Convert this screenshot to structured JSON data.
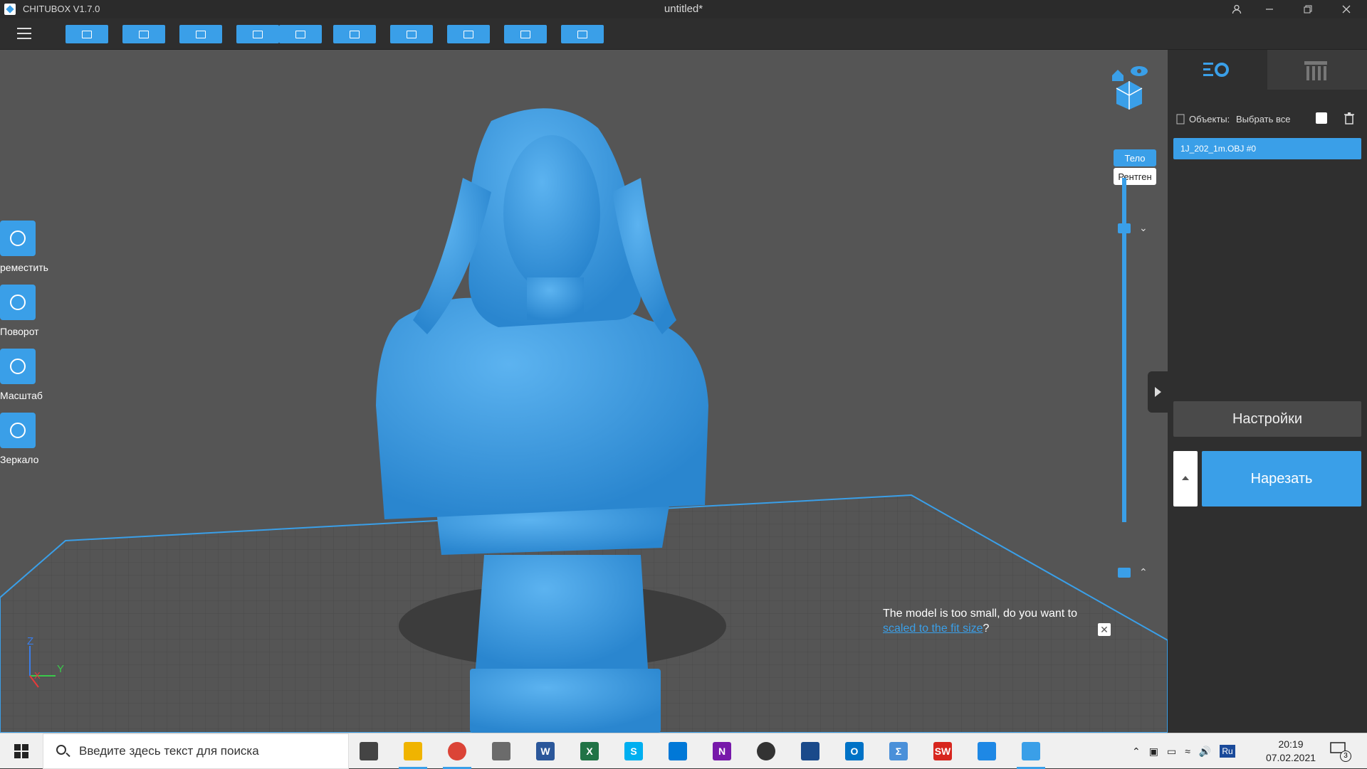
{
  "window": {
    "app_name": "CHITUBOX V1.7.0",
    "document_title": "untitled*"
  },
  "toolbar": {
    "buttons": [
      "open-file",
      "save",
      "import",
      "undo",
      "redo",
      "copy",
      "arrange",
      "support",
      "hollow",
      "dig-hole"
    ]
  },
  "left_tools": [
    {
      "label": "Переместить",
      "visible_label": "реместить",
      "icon": "move-icon"
    },
    {
      "label": "Поворот",
      "visible_label": "Поворот",
      "icon": "rotate-icon"
    },
    {
      "label": "Масштаб",
      "visible_label": "Масштаб",
      "icon": "scale-icon"
    },
    {
      "label": "Зеркало",
      "visible_label": "Зеркало",
      "icon": "mirror-icon"
    }
  ],
  "view_modes": {
    "body": "Тело",
    "xray": "Рентген",
    "active": "body"
  },
  "axes": {
    "z": "Z",
    "y": "Y",
    "x": "X"
  },
  "notice": {
    "text": "The model is too small, do you want to",
    "link": "scaled to the fit size",
    "suffix": "?"
  },
  "sidepanel": {
    "objects_label": "Объекты:",
    "select_all_label": "Выбрать все",
    "objects": [
      "1J_202_1m.OBJ #0"
    ],
    "settings_button": "Настройки",
    "slice_button": "Нарезать"
  },
  "taskbar": {
    "search_placeholder": "Введите здесь текст для поиска",
    "apps": [
      {
        "name": "task-view",
        "color": "#444444",
        "glyph": ""
      },
      {
        "name": "file-explorer",
        "color": "#f0b400",
        "glyph": ""
      },
      {
        "name": "chrome",
        "color": "#db4437",
        "glyph": ""
      },
      {
        "name": "calculator",
        "color": "#6b6b6b",
        "glyph": ""
      },
      {
        "name": "word",
        "color": "#2b579a",
        "glyph": "W"
      },
      {
        "name": "excel",
        "color": "#217346",
        "glyph": "X"
      },
      {
        "name": "skype",
        "color": "#00aff0",
        "glyph": "S"
      },
      {
        "name": "vscode",
        "color": "#0078d7",
        "glyph": ""
      },
      {
        "name": "onenote",
        "color": "#7719aa",
        "glyph": "N"
      },
      {
        "name": "media-player",
        "color": "#333333",
        "glyph": ""
      },
      {
        "name": "virtualbox",
        "color": "#1a4a8a",
        "glyph": ""
      },
      {
        "name": "outlook",
        "color": "#0072c6",
        "glyph": "O"
      },
      {
        "name": "sigma-app",
        "color": "#4a90d9",
        "glyph": "Σ"
      },
      {
        "name": "solidworks",
        "color": "#d7261e",
        "glyph": "SW"
      },
      {
        "name": "cloud-app",
        "color": "#1e88e5",
        "glyph": ""
      },
      {
        "name": "chitubox",
        "color": "#3a9fe8",
        "glyph": ""
      }
    ],
    "language": "Ru",
    "time": "20:19",
    "date": "07.02.2021",
    "notification_count": "3"
  },
  "colors": {
    "accent": "#3a9fe8",
    "viewport_bg": "#555555",
    "model": "#3a9fe8"
  }
}
